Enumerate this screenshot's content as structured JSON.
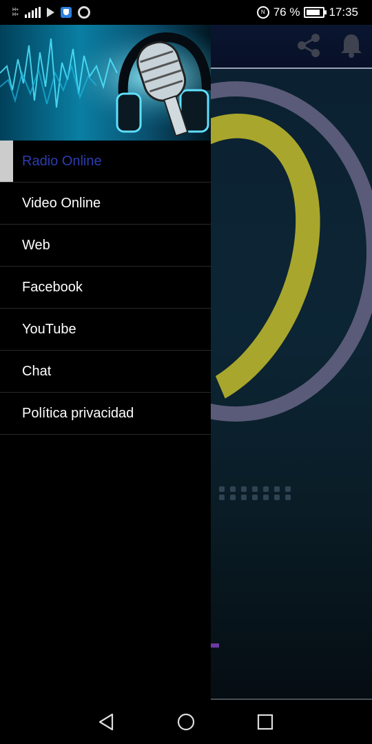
{
  "status_bar": {
    "network_label_top": "H+",
    "network_label_bottom": "H+",
    "battery_percent": "76 %",
    "time": "17:35"
  },
  "drawer": {
    "items": [
      {
        "label": "Radio Online",
        "selected": true
      },
      {
        "label": "Video Online",
        "selected": false
      },
      {
        "label": "Web",
        "selected": false
      },
      {
        "label": "Facebook",
        "selected": false
      },
      {
        "label": "YouTube",
        "selected": false
      },
      {
        "label": "Chat",
        "selected": false
      },
      {
        "label": "Política privacidad",
        "selected": false
      }
    ]
  },
  "toolbar_icons": [
    "share-icon",
    "notification-bell-icon"
  ],
  "colors": {
    "selected_text": "#2c3cb0",
    "drawer_bg": "#000000",
    "header_cyan": "#0a7fa3"
  }
}
